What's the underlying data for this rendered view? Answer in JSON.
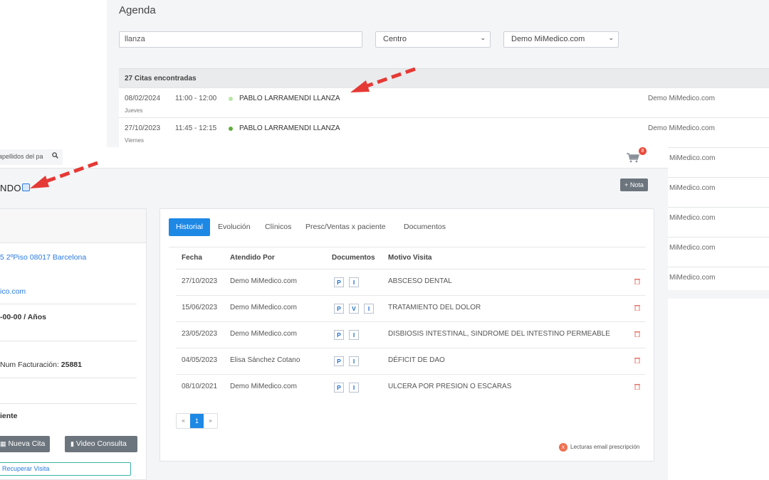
{
  "agenda": {
    "title": "Agenda",
    "search_value": "llanza",
    "centro_select": "Centro",
    "clinic_select": "Demo MiMedico.com",
    "results_header": "27 Citas encontradas",
    "rows": [
      {
        "date": "08/02/2024",
        "day": "Jueves",
        "time": "11:00 - 12:00",
        "patient": "PABLO LARRAMENDI LLANZA",
        "center": "Demo MiMedico.com",
        "status_color": "#b9e5a5"
      },
      {
        "date": "27/10/2023",
        "day": "Viernes",
        "time": "11:45 - 12:15",
        "patient": "PABLO LARRAMENDI LLANZA",
        "center": "Demo MiMedico.com",
        "status_color": "#5fae3c"
      }
    ],
    "partial_centers": [
      "MiMedico.com",
      "MiMedico.com",
      "MiMedico.com",
      "MiMedico.com",
      "MiMedico.com"
    ]
  },
  "patient": {
    "top_search_placeholder": "apellidos del pa",
    "cart_count": "8",
    "name_fragment": "NDO",
    "nota_button": "+ Nota",
    "left": {
      "address": "5 2ºPiso 08017 Barcelona",
      "email": "ico.com",
      "age": "-00-00 / Años",
      "billing_label": "Num Facturación: ",
      "billing_number": "25881",
      "section": "iente",
      "new_appointment": "Nueva Cita",
      "video_consult": "Video Consulta",
      "recover_visit": "Recuperar Visita"
    },
    "tabs": [
      "Historial",
      "Evolución",
      "Clínicos",
      "Presc/Ventas x paciente",
      "Documentos"
    ],
    "table": {
      "headers": [
        "Fecha",
        "Atendido Por",
        "Documentos",
        "Motivo Visita"
      ],
      "rows": [
        {
          "fecha": "27/10/2023",
          "atendido": "Demo MiMedico.com",
          "docs": [
            "P",
            "I"
          ],
          "motivo": "ABSCESO DENTAL"
        },
        {
          "fecha": "15/06/2023",
          "atendido": "Demo MiMedico.com",
          "docs": [
            "P",
            "V",
            "I"
          ],
          "motivo": "TRATAMIENTO DEL DOLOR"
        },
        {
          "fecha": "23/05/2023",
          "atendido": "Demo MiMedico.com",
          "docs": [
            "P",
            "I"
          ],
          "motivo": "DISBIOSIS INTESTINAL, SINDROME DEL INTESTINO PERMEABLE"
        },
        {
          "fecha": "04/05/2023",
          "atendido": "Elisa Sánchez Cotano",
          "docs": [
            "P",
            "I"
          ],
          "motivo": "DÉFICIT DE DAO"
        },
        {
          "fecha": "08/10/2021",
          "atendido": "Demo MiMedico.com",
          "docs": [
            "P",
            "I"
          ],
          "motivo": "ULCERA POR PRESION O ESCARAS"
        }
      ]
    },
    "pager": {
      "prev": "«",
      "current": "1",
      "next": "»"
    },
    "lecturas_icon": "x",
    "lecturas": "Lecturas email prescripción"
  },
  "colors": {
    "accent": "#1e88e5",
    "arrow": "#e53935",
    "badge": "#e74c3c"
  }
}
